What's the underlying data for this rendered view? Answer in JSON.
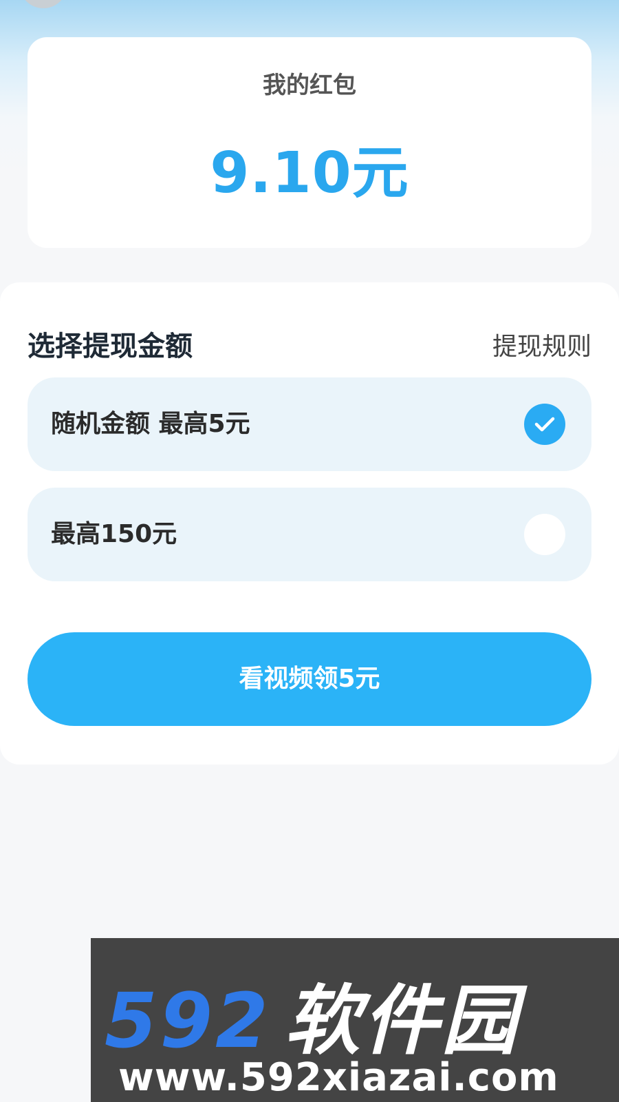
{
  "balance": {
    "label": "我的红包",
    "amount": "9.10元"
  },
  "withdraw": {
    "title": "选择提现金额",
    "rules_link": "提现规则",
    "options": [
      {
        "label": "随机金额 最高5元",
        "selected": true
      },
      {
        "label": "最高150元",
        "selected": false
      }
    ],
    "cta_label": "看视频领5元"
  },
  "watermark": {
    "logo_number": "592",
    "logo_text": "软件园",
    "url": "www.592xiazai.com"
  },
  "colors": {
    "accent": "#2aa7ee",
    "button": "#2bb3f7",
    "option_bg": "#eaf4fa",
    "watermark_blue": "#2f79e8",
    "watermark_bg": "#444444"
  },
  "icons": {
    "check": "check-icon"
  }
}
